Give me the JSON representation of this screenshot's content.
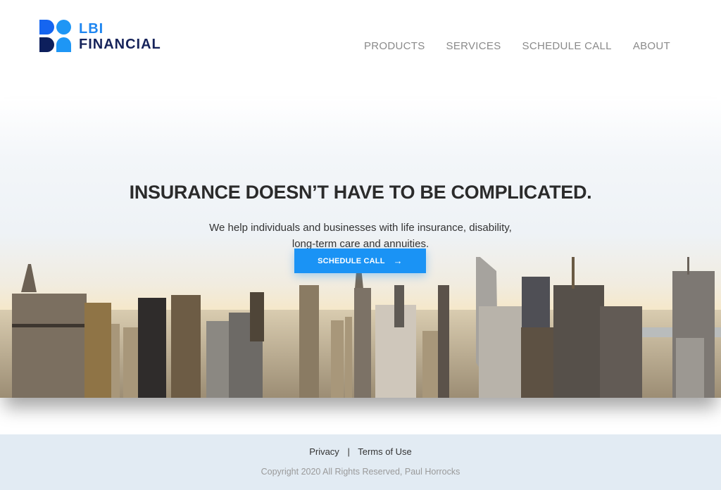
{
  "brand": {
    "line1": "LBI",
    "line2": "FINANCIAL",
    "colors": {
      "primary": "#1565f0",
      "light": "#1e96f5",
      "dark": "#0d1f5c"
    }
  },
  "nav": {
    "items": [
      {
        "label": "PRODUCTS"
      },
      {
        "label": "SERVICES"
      },
      {
        "label": "SCHEDULE CALL"
      },
      {
        "label": "ABOUT"
      }
    ]
  },
  "hero": {
    "title": "INSURANCE DOESN’T HAVE TO BE COMPLICATED.",
    "subtitle": "We help individuals and businesses with life insurance, disability, long-term care and annuities.",
    "cta_label": "SCHEDULE CALL",
    "cta_icon": "→",
    "cta_color": "#1a93f5",
    "background_image": "city-skyline"
  },
  "footer": {
    "links": [
      {
        "label": "Privacy"
      },
      {
        "label": "Terms of Use"
      }
    ],
    "separator": "|",
    "copyright": "Copyright 2020 All Rights Reserved, Paul Horrocks"
  }
}
